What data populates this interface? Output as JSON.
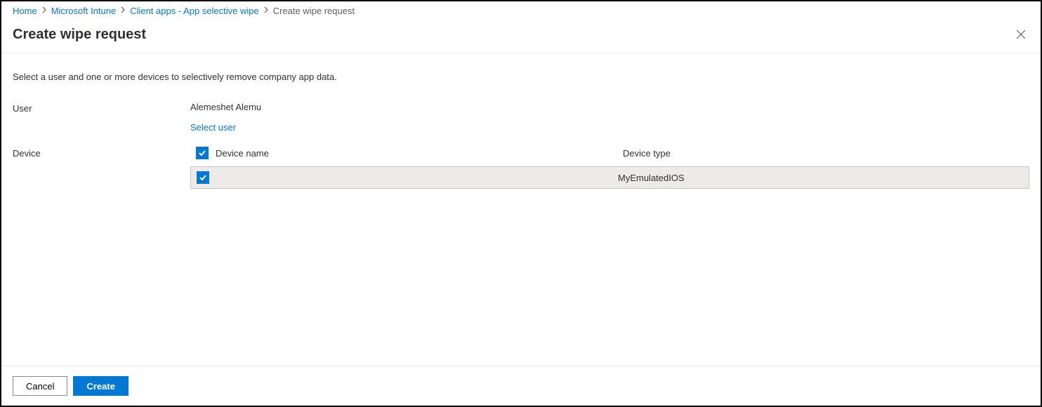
{
  "breadcrumb": {
    "items": [
      {
        "label": "Home",
        "link": true
      },
      {
        "label": "Microsoft Intune",
        "link": true
      },
      {
        "label": "Client apps - App selective wipe",
        "link": true
      },
      {
        "label": "Create wipe request",
        "link": false
      }
    ]
  },
  "header": {
    "title": "Create wipe request"
  },
  "main": {
    "intro": "Select a user and one or more devices to selectively remove company app data.",
    "user_label": "User",
    "user_value": "Alemeshet Alemu",
    "select_user_link": "Select user",
    "device_label": "Device",
    "columns": {
      "name": "Device name",
      "type": "Device type"
    },
    "devices": [
      {
        "name": "",
        "type": "MyEmulatedIOS",
        "checked": true
      }
    ]
  },
  "footer": {
    "cancel": "Cancel",
    "create": "Create"
  }
}
